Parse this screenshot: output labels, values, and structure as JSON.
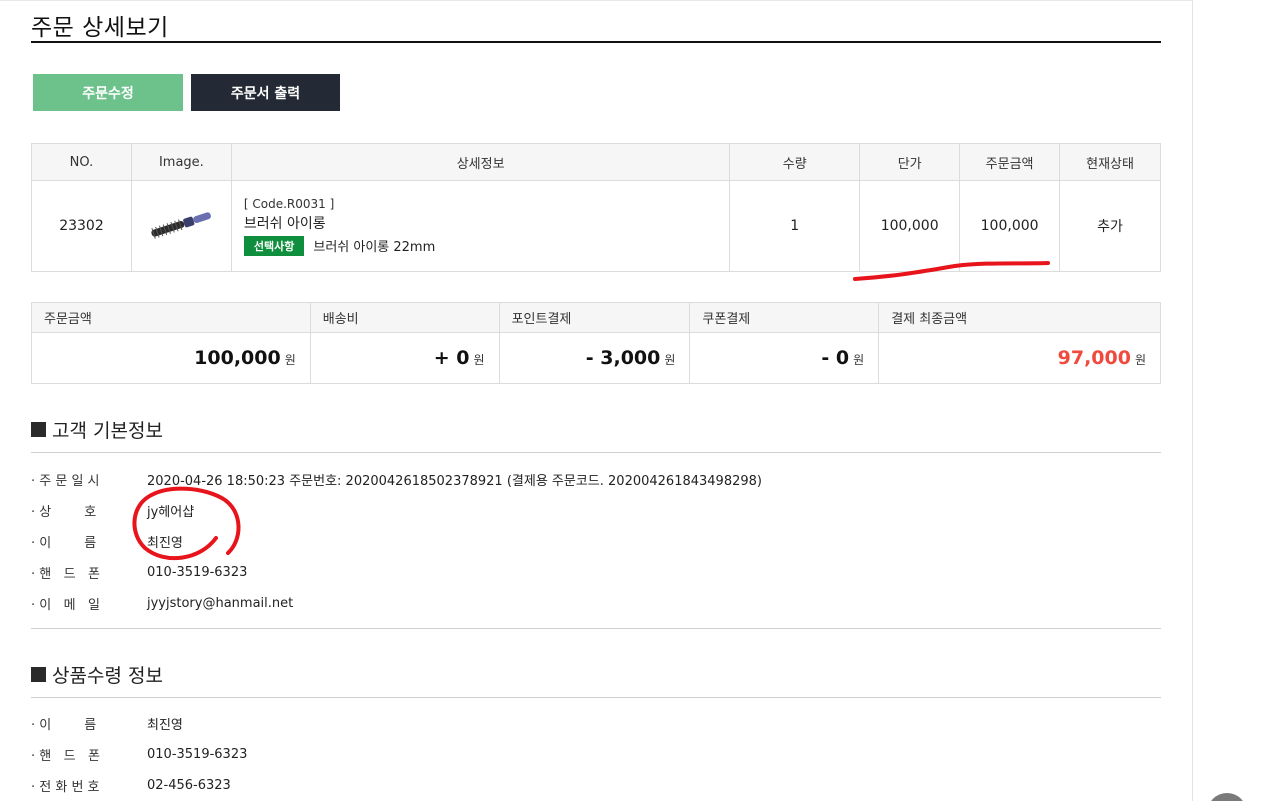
{
  "page": {
    "title": "주문 상세보기"
  },
  "buttons": {
    "edit": "주문수정",
    "print": "주문서 출력"
  },
  "items_table": {
    "headers": [
      "NO.",
      "Image.",
      "상세정보",
      "수량",
      "단가",
      "주문금액",
      "현재상태"
    ],
    "row": {
      "no": "23302",
      "code": "[ Code.R0031 ]",
      "name": "브러쉬 아이롱",
      "option_badge": "선택사항",
      "option_text": "브러쉬 아이롱 22mm",
      "qty": "1",
      "unit_price": "100,000",
      "order_amount": "100,000",
      "status": "추가"
    }
  },
  "totals_table": {
    "headers": [
      "주문금액",
      "배송비",
      "포인트결제",
      "쿠폰결제",
      "결제 최종금액"
    ],
    "values": [
      "100,000",
      "+ 0",
      "- 3,000",
      "- 0",
      "97,000"
    ],
    "unit": "원"
  },
  "customer": {
    "title": "고객 기본정보",
    "rows": [
      {
        "label": "· 주 문 일 시",
        "value": "2020-04-26 18:50:23  주문번호:  20200426185023789​21 (결제용 주문코드. 202004261843498298)"
      },
      {
        "label": "· 상        호",
        "value": "jy헤어샵"
      },
      {
        "label": "· 이        름",
        "value": "최진영"
      },
      {
        "label": "· 핸   드   폰",
        "value": "010-3519-6323"
      },
      {
        "label": "· 이   메   일",
        "value": "jyyjstory@hanmail.net"
      }
    ]
  },
  "receiver": {
    "title": "상품수령 정보",
    "rows": [
      {
        "label": "· 이        름",
        "value": "최진영"
      },
      {
        "label": "· 핸   드   폰",
        "value": "010-3519-6323"
      },
      {
        "label": "· 전 화 번 호",
        "value": "02-456-6323"
      }
    ]
  },
  "colors": {
    "edit_button": "#6dc18b",
    "print_button": "#232a36",
    "option_badge": "#0f8f3d",
    "final_amount": "#f04a3f",
    "annotation": "#e8141b"
  }
}
